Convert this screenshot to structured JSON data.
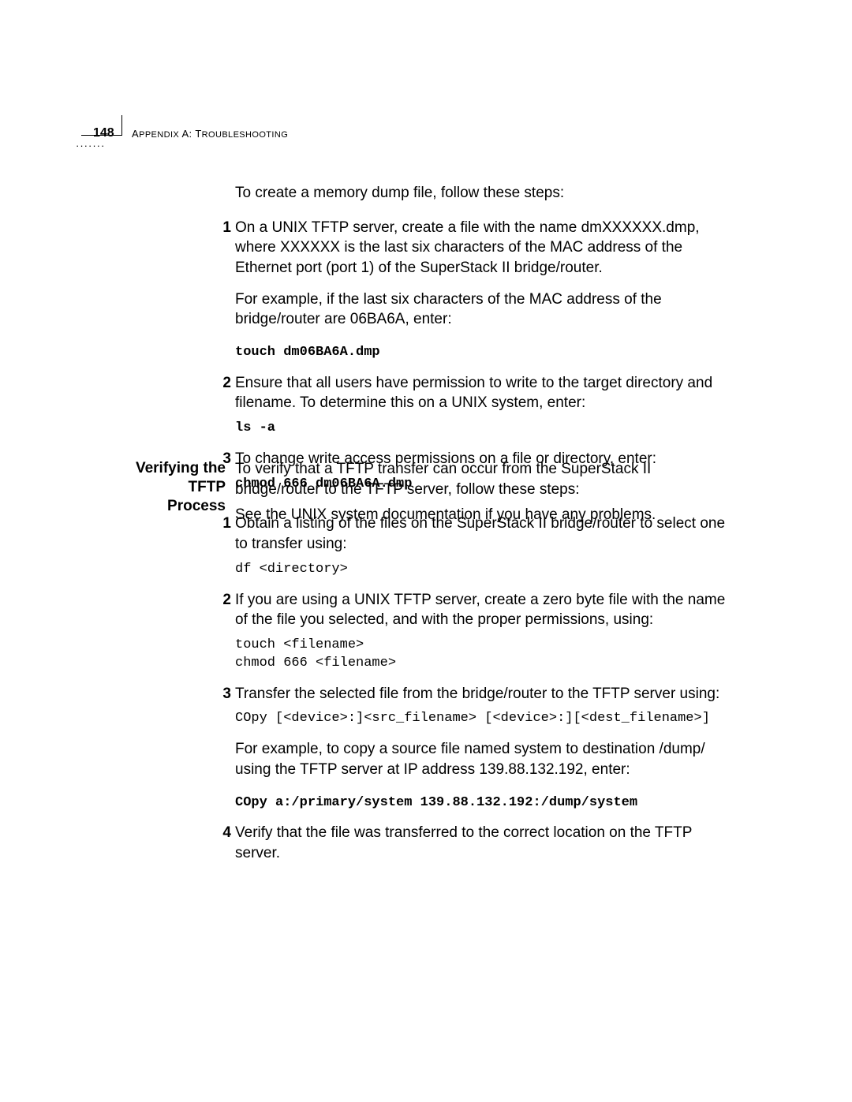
{
  "header": {
    "page_number": "148",
    "appendix_prefix": "A",
    "appendix_word_rest": "PPENDIX",
    "appendix_letter": " A: T",
    "appendix_word2_rest": "ROUBLESHOOTING"
  },
  "section1": {
    "intro": "To create a memory dump file, follow these steps:",
    "steps": [
      {
        "num": "1",
        "text": "On a UNIX TFTP server, create a file with the name dmXXXXXX.dmp, where XXXXXX is the last six characters of the MAC address of the Ethernet port (port 1) of the SuperStack II bridge/router.",
        "after_text": "For example, if the last six characters of the MAC address of the bridge/router are 06BA6A, enter:",
        "code": "touch dm06BA6A.dmp",
        "code_bold": true
      },
      {
        "num": "2",
        "text": "Ensure that all users have permission to write to the target directory and filename. To determine this on a UNIX system, enter:",
        "code": "ls -a",
        "code_bold": true
      },
      {
        "num": "3",
        "text": "To change write access permissions on a file or directory, enter:",
        "code": "chmod 666 dm06BA6A.dmp",
        "code_bold": true,
        "after_code": "See the UNIX system documentation if you have any problems."
      }
    ]
  },
  "section2": {
    "heading_line1": "Verifying the TFTP",
    "heading_line2": "Process",
    "intro": "To verify that a TFTP transfer can occur from the SuperStack II bridge/router to the TFTP server, follow these steps:",
    "steps": [
      {
        "num": "1",
        "text": "Obtain a listing of the files on the SuperStack II bridge/router to select one to transfer using:",
        "code": "df <directory>",
        "code_bold": false
      },
      {
        "num": "2",
        "text": "If you are using a UNIX TFTP server, create a zero byte file with the name of the file you selected, and with the proper permissions, using:",
        "code": "touch <filename>\nchmod 666 <filename>",
        "code_bold": false
      },
      {
        "num": "3",
        "text": "Transfer the selected file from the bridge/router to the TFTP server using:",
        "code": "COpy [<device>:]<src_filename> [<device>:][<dest_filename>]",
        "code_bold": false,
        "after_code": "For example, to copy a source file named system to destination /dump/ using the TFTP server at IP address 139.88.132.192, enter:",
        "code2": "COpy a:/primary/system 139.88.132.192:/dump/system",
        "code2_bold": true
      },
      {
        "num": "4",
        "text": "Verify that the file was transferred to the correct location on the TFTP server."
      }
    ]
  }
}
